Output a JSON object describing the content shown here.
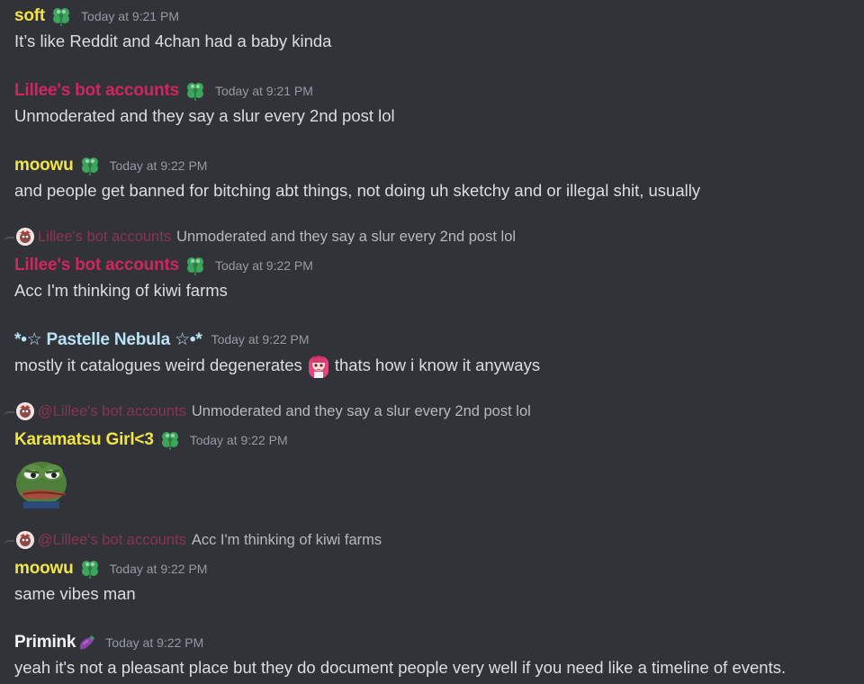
{
  "messages": [
    {
      "author": "soft",
      "author_color": "#f0e446",
      "badge": "clover-icon",
      "time": "Today at 9:21 PM",
      "text": "It’s like Reddit and 4chan had a baby kinda"
    },
    {
      "author": "Lillee's bot accounts",
      "author_color": "#d0265e",
      "badge": "clover-icon",
      "time": "Today at 9:21 PM",
      "text": "Unmoderated and they say a slur every 2nd post lol"
    },
    {
      "author": "moowu",
      "author_color": "#f0e446",
      "badge": "clover-icon",
      "time": "Today at 9:22 PM",
      "text": "and people get banned for bitching abt things, not doing uh sketchy and or illegal shit, usually"
    },
    {
      "reply_to": {
        "author": "Lillee's bot accounts",
        "text": "Unmoderated and they say a slur every 2nd post lol"
      },
      "author": "Lillee's bot accounts",
      "author_color": "#d0265e",
      "badge": "clover-icon",
      "time": "Today at 9:22 PM",
      "text": "Acc I'm thinking of kiwi farms"
    },
    {
      "author": "*•☆ Pastelle Nebula ☆•*",
      "author_color": "#b8e4f7",
      "time": "Today at 9:22 PM",
      "text_before": "mostly it catalogues weird degenerates",
      "emoji": "anime-girl-emoji",
      "text_after": "thats how i know it anyways"
    },
    {
      "reply_to": {
        "author": "@Lillee's bot accounts",
        "text": "Unmoderated and they say a slur every 2nd post lol"
      },
      "author": "Karamatsu Girl<3",
      "author_color": "#f0e446",
      "badge": "clover-icon",
      "time": "Today at 9:22 PM",
      "sticker": "sad-pepe-frog-emoji"
    },
    {
      "reply_to": {
        "author": "@Lillee's bot accounts",
        "text": "Acc I'm thinking of kiwi farms"
      },
      "author": "moowu",
      "author_color": "#f0e446",
      "badge": "clover-icon",
      "time": "Today at 9:22 PM",
      "text": "same vibes man"
    },
    {
      "author": "Primink",
      "author_color": "#f2f3f5",
      "author_emoji": "eggplant-emoji",
      "time": "Today at 9:22 PM",
      "text": "yeah it's not a pleasant place but they do document people very well if you need like a timeline of events."
    }
  ]
}
